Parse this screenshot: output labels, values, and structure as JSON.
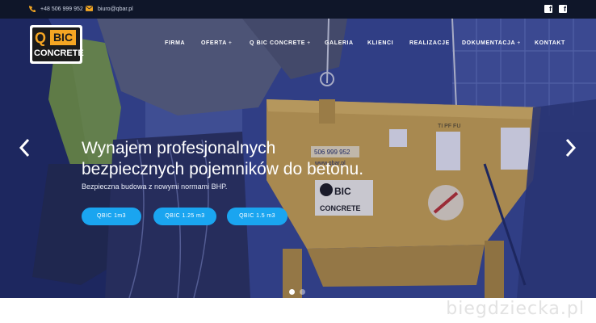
{
  "topbar": {
    "phone": "+48 506 999 952",
    "email": "biuro@qbar.pl",
    "social": [
      "facebook-icon",
      "facebook-icon"
    ]
  },
  "logo": {
    "q": "Q",
    "bic": "BIC",
    "concrete": "CONCRETE"
  },
  "nav": {
    "items": [
      {
        "label": "FIRMA",
        "plus": ""
      },
      {
        "label": "OFERTA",
        "plus": "+"
      },
      {
        "label": "Q BIC CONCRETE",
        "plus": "+"
      },
      {
        "label": "GALERIA",
        "plus": ""
      },
      {
        "label": "KLIENCI",
        "plus": ""
      },
      {
        "label": "REALIZACJE",
        "plus": ""
      },
      {
        "label": "DOKUMENTACJA",
        "plus": "+"
      },
      {
        "label": "KONTAKT",
        "plus": ""
      }
    ]
  },
  "hero": {
    "headline_line1": "Wynajem profesjonalnych",
    "headline_line2": "bezpiecznych pojemników do betonu.",
    "subline": "Bezpieczna budowa z nowymi normami BHP.",
    "buttons": [
      "QBIC 1m3",
      "QBIC 1.25 m3",
      "QBIC 1.5 m3"
    ],
    "arrow_left": "‹",
    "arrow_right": "›",
    "slides_total": 2,
    "slide_active": 1
  },
  "container_print": {
    "phone": "506 999 952",
    "site": "www.qbar.pl",
    "logo_bic": "BIC",
    "logo_concrete": "CONCRETE",
    "tag": "TI PF FU"
  },
  "watermark": "biegdziecka.pl",
  "colors": {
    "accent_blue": "#1aa5f0",
    "topbar_bg": "#0f1629",
    "logo_orange": "#f5a623",
    "container_yellow": "#d6a84a"
  }
}
